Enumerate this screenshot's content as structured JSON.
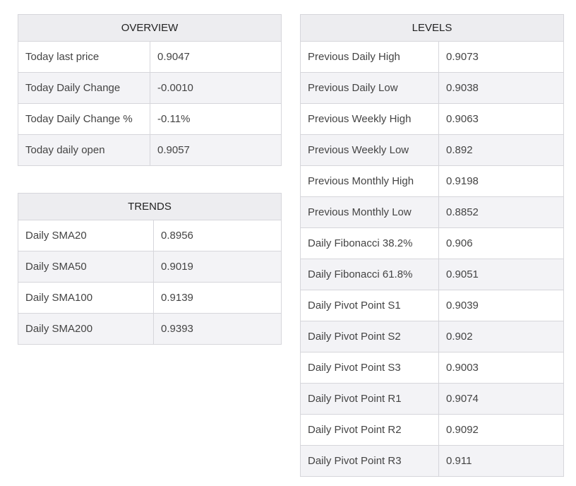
{
  "overview": {
    "title": "OVERVIEW",
    "rows": [
      {
        "label": "Today last price",
        "value": "0.9047"
      },
      {
        "label": "Today Daily Change",
        "value": "-0.0010"
      },
      {
        "label": "Today Daily Change %",
        "value": "-0.11%"
      },
      {
        "label": "Today daily open",
        "value": "0.9057"
      }
    ]
  },
  "trends": {
    "title": "TRENDS",
    "rows": [
      {
        "label": "Daily SMA20",
        "value": "0.8956"
      },
      {
        "label": "Daily SMA50",
        "value": "0.9019"
      },
      {
        "label": "Daily SMA100",
        "value": "0.9139"
      },
      {
        "label": "Daily SMA200",
        "value": "0.9393"
      }
    ]
  },
  "levels": {
    "title": "LEVELS",
    "rows": [
      {
        "label": "Previous Daily High",
        "value": "0.9073"
      },
      {
        "label": "Previous Daily Low",
        "value": "0.9038"
      },
      {
        "label": "Previous Weekly High",
        "value": "0.9063"
      },
      {
        "label": "Previous Weekly Low",
        "value": "0.892"
      },
      {
        "label": "Previous Monthly High",
        "value": "0.9198"
      },
      {
        "label": "Previous Monthly Low",
        "value": "0.8852"
      },
      {
        "label": "Daily Fibonacci 38.2%",
        "value": "0.906"
      },
      {
        "label": "Daily Fibonacci 61.8%",
        "value": "0.9051"
      },
      {
        "label": "Daily Pivot Point S1",
        "value": "0.9039"
      },
      {
        "label": "Daily Pivot Point S2",
        "value": "0.902"
      },
      {
        "label": "Daily Pivot Point S3",
        "value": "0.9003"
      },
      {
        "label": "Daily Pivot Point R1",
        "value": "0.9074"
      },
      {
        "label": "Daily Pivot Point R2",
        "value": "0.9092"
      },
      {
        "label": "Daily Pivot Point R3",
        "value": "0.911"
      }
    ]
  }
}
